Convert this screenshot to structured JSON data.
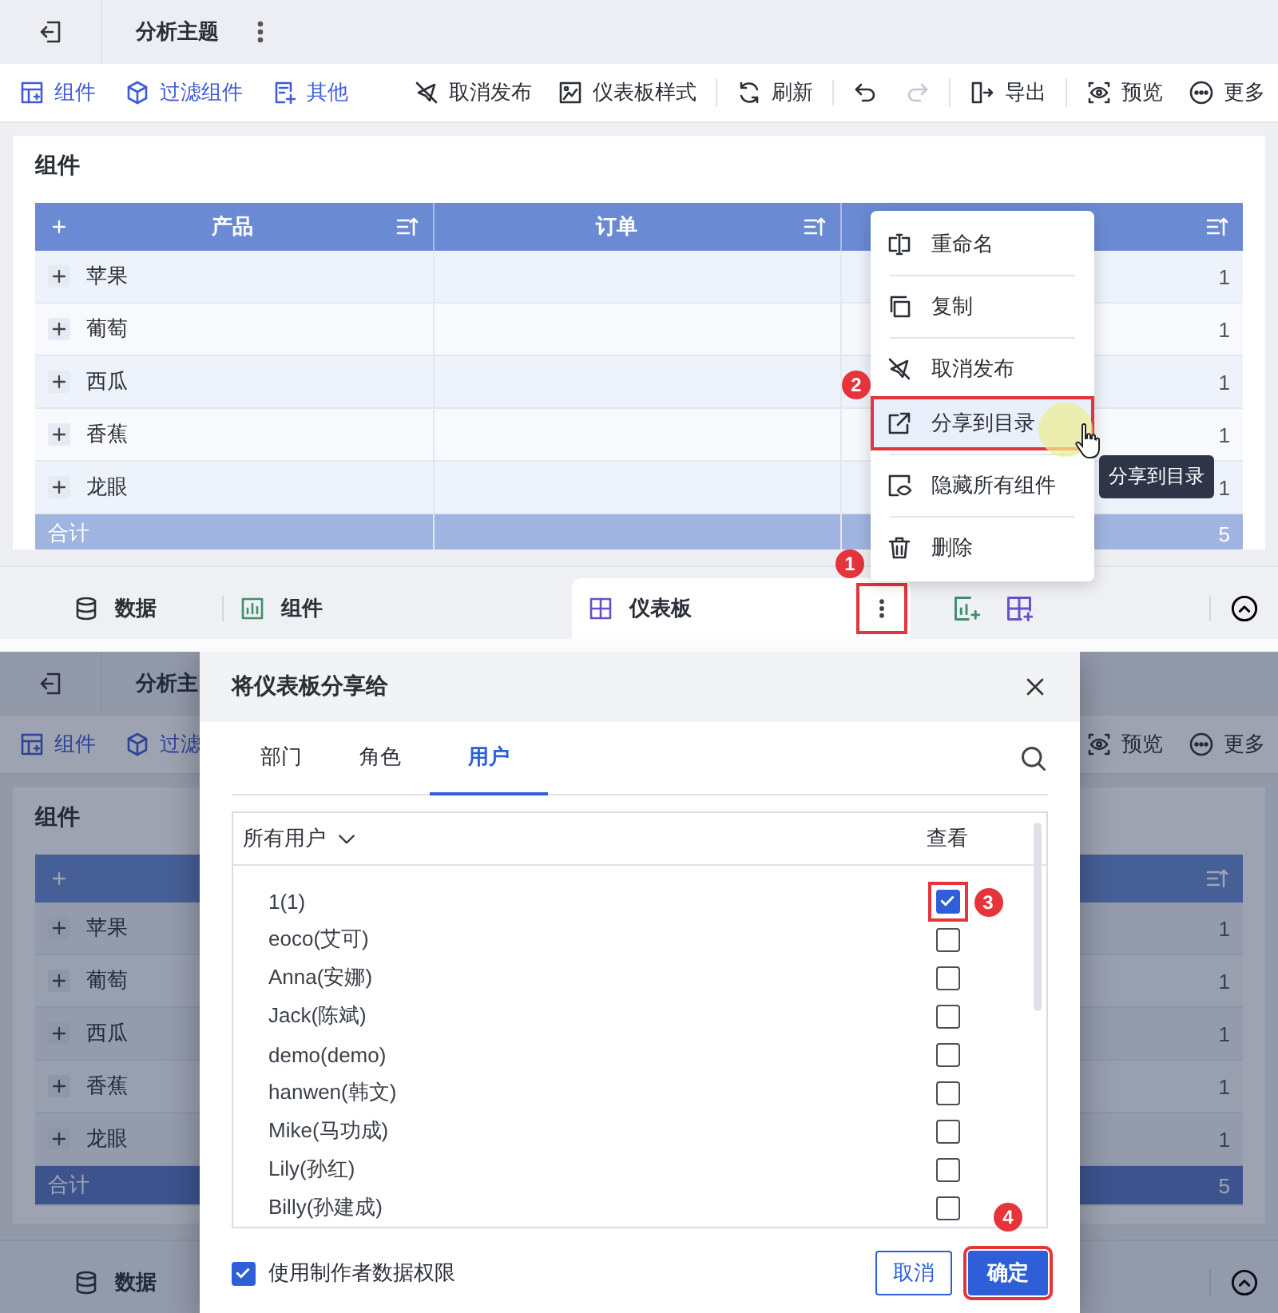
{
  "top": {
    "header": {
      "title": "分析主题"
    },
    "toolbar": {
      "left": [
        {
          "label": "组件",
          "kind": "widget"
        },
        {
          "label": "过滤组件",
          "kind": "cube"
        },
        {
          "label": "其他",
          "kind": "doc"
        }
      ],
      "right": [
        [
          {
            "label": "取消发布",
            "kind": "unpublish"
          },
          {
            "label": "仪表板样式",
            "kind": "style"
          }
        ],
        [
          {
            "label": "刷新",
            "kind": "refresh"
          }
        ],
        [
          {
            "kind": "undo",
            "disabled": false
          },
          {
            "kind": "redo",
            "disabled": true
          }
        ],
        [
          {
            "label": "导出",
            "kind": "export"
          }
        ],
        [
          {
            "label": "预览",
            "kind": "eye"
          },
          {
            "label": "更多",
            "kind": "more"
          }
        ]
      ]
    },
    "card": {
      "title": "组件",
      "columns": [
        {
          "label": "产品"
        },
        {
          "label": "订单"
        }
      ],
      "rows": [
        {
          "name": "苹果",
          "value": "1"
        },
        {
          "name": "葡萄",
          "value": "1"
        },
        {
          "name": "西瓜",
          "value": "1"
        },
        {
          "name": "香蕉",
          "value": "1"
        },
        {
          "name": "龙眼",
          "value": "1"
        }
      ],
      "total": {
        "label": "合计",
        "value": "5"
      }
    },
    "tabs": [
      {
        "label": "数据",
        "kind": "database",
        "selected": false
      },
      {
        "label": "组件",
        "kind": "chart",
        "selected": false
      },
      {
        "label": "仪表板",
        "kind": "grid",
        "selected": true,
        "step": "1"
      }
    ],
    "menu": {
      "groups": [
        [
          {
            "label": "重命名",
            "kind": "rename",
            "selected": false
          }
        ],
        [
          {
            "label": "复制",
            "kind": "copy",
            "selected": false
          }
        ],
        [
          {
            "label": "取消发布",
            "kind": "unpublish",
            "selected": false
          },
          {
            "label": "分享到目录",
            "kind": "share",
            "selected": true,
            "step": "2"
          }
        ],
        [
          {
            "label": "隐藏所有组件",
            "kind": "hide",
            "selected": false
          }
        ],
        [
          {
            "label": "删除",
            "kind": "trash",
            "selected": false
          }
        ]
      ],
      "tooltip": "分享到目录"
    }
  },
  "bottom": {
    "background": {
      "header": {
        "title": "分析主"
      },
      "toolbar": {
        "left": [
          {
            "label": "组件",
            "kind": "widget"
          },
          {
            "label": "过滤",
            "kind": "cube"
          }
        ],
        "right": [
          [
            {
              "label": "预览",
              "kind": "eye"
            },
            {
              "label": "更多",
              "kind": "more"
            }
          ]
        ]
      },
      "card": {
        "title": "组件",
        "rows": [
          {
            "name": "苹果",
            "value": "1"
          },
          {
            "name": "葡萄",
            "value": "1"
          },
          {
            "name": "西瓜",
            "value": "1"
          },
          {
            "name": "香蕉",
            "value": "1"
          },
          {
            "name": "龙眼",
            "value": "1"
          }
        ],
        "total": {
          "label": "合计",
          "value": "5"
        }
      },
      "tabs": [
        {
          "label": "数据",
          "kind": "database",
          "selected": false
        }
      ]
    },
    "dialog": {
      "title": "将仪表板分享给",
      "tabs": [
        {
          "label": "部门",
          "selected": false
        },
        {
          "label": "角色",
          "selected": false
        },
        {
          "label": "用户",
          "selected": true
        }
      ],
      "list_header": {
        "filter": "所有用户",
        "permission": "查看"
      },
      "users": [
        {
          "name": "1(1)",
          "checked": true,
          "step": "3"
        },
        {
          "name": "eoco(艾可)",
          "checked": false
        },
        {
          "name": "Anna(安娜)",
          "checked": false
        },
        {
          "name": "Jack(陈斌)",
          "checked": false
        },
        {
          "name": "demo(demo)",
          "checked": false
        },
        {
          "name": "hanwen(韩文)",
          "checked": false
        },
        {
          "name": "Mike(马功成)",
          "checked": false
        },
        {
          "name": "Lily(孙红)",
          "checked": false
        },
        {
          "name": "Billy(孙建成)",
          "checked": false
        }
      ],
      "option": {
        "label": "使用制作者数据权限",
        "checked": true
      },
      "cancel": "取消",
      "confirm": {
        "label": "确定",
        "step": "4"
      }
    }
  }
}
